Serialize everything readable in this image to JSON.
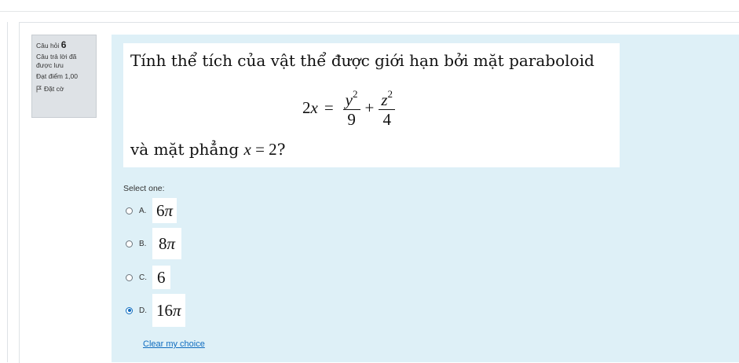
{
  "info": {
    "question_label": "Câu hỏi",
    "question_number": "6",
    "status": "Câu trả lời đã được lưu",
    "mark": "Đạt điểm 1,00",
    "flag_label": "Đặt cờ"
  },
  "question": {
    "line1": "Tính thể tích của vật thể được giới hạn bởi mặt paraboloid",
    "formula_lhs_coef": "2",
    "formula_lhs_var": "x",
    "formula_eq": "=",
    "frac1_num_var": "y",
    "frac1_num_exp": "2",
    "frac1_den": "9",
    "formula_plus": "+",
    "frac2_num_var": "z",
    "frac2_num_exp": "2",
    "frac2_den": "4",
    "line2_prefix": "và mặt phẳng ",
    "line2_var": "x",
    "line2_rest": " = 2",
    "line2_suffix": "?"
  },
  "prompt": "Select one:",
  "options": [
    {
      "letter": "A.",
      "value": "6",
      "pi": "π",
      "selected": false
    },
    {
      "letter": "B.",
      "value": "8",
      "pi": "π",
      "selected": false
    },
    {
      "letter": "C.",
      "value": "6",
      "pi": "",
      "selected": false
    },
    {
      "letter": "D.",
      "value": "16",
      "pi": "π",
      "selected": true
    }
  ],
  "clear_choice": "Clear my choice",
  "colors": {
    "content_bg": "#def0f7",
    "info_bg": "#dee2e6",
    "link": "#0f6cbf"
  }
}
